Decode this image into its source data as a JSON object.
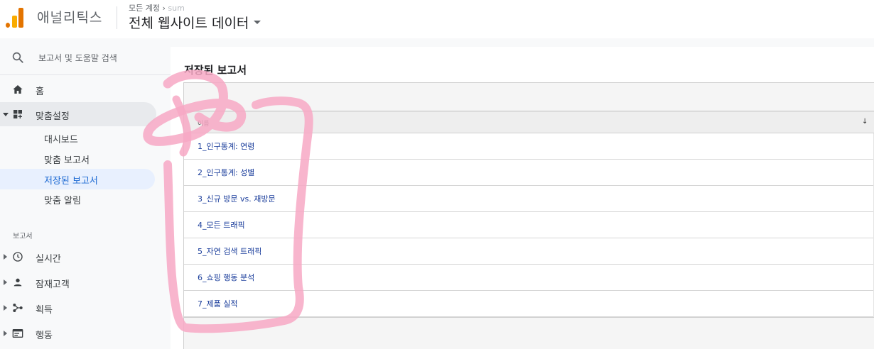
{
  "header": {
    "app_name": "애널리틱스",
    "breadcrumb_account": "모든 계정",
    "breadcrumb_sep": "›",
    "breadcrumb_blurred": "sum",
    "property_name": "전체 웹사이트 데이터"
  },
  "sidebar": {
    "search_placeholder": "보고서 및 도움말 검색",
    "home": "홈",
    "customization": "맞춤설정",
    "sub_items": [
      "대시보드",
      "맞춤 보고서",
      "저장된 보고서",
      "맞춤 알림"
    ],
    "reports_section": "보고서",
    "report_items": [
      "실시간",
      "잠재고객",
      "획득",
      "행동"
    ]
  },
  "main": {
    "title": "저장된 보고서",
    "column_name": "이름",
    "sort_glyph": "↓",
    "reports": [
      "1_인구통계: 연령",
      "2_인구통계: 성별",
      "3_신규 방문 vs. 재방문",
      "4_모든 트래픽",
      "5_자연 검색 트래픽",
      "6_쇼핑 행동 분석",
      "7_제품 실적"
    ]
  },
  "colors": {
    "logo_orange": "#f9ab00",
    "logo_dark_orange": "#e37400",
    "link_blue": "#1a3d9b",
    "selected_bg": "#e8f0fe",
    "scribble_pink": "#f7a8c4"
  }
}
